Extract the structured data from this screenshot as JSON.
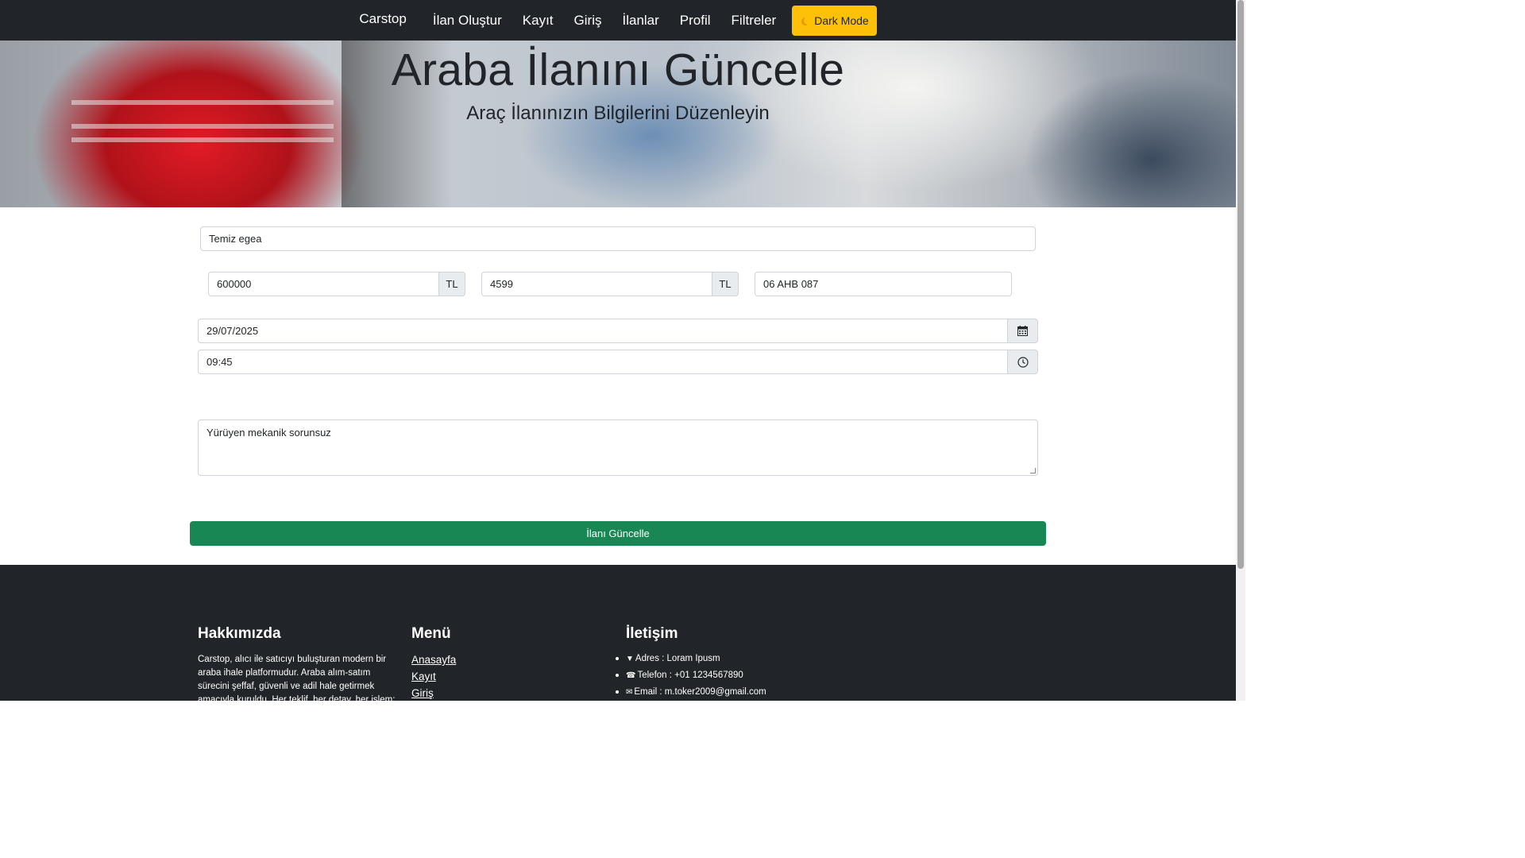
{
  "nav": {
    "brand": "Carstop",
    "links": [
      "İlan Oluştur",
      "Kayıt",
      "Giriş",
      "İlanlar",
      "Profil",
      "Filtreler"
    ],
    "dark_mode": "Dark Mode"
  },
  "hero": {
    "title": "Araba İlanını Güncelle",
    "subtitle": "Araç İlanınızın Bilgilerini Düzenleyin"
  },
  "form": {
    "title_value": "Temiz egea",
    "price_value": "600000",
    "price_unit": "TL",
    "second_value": "4599",
    "second_unit": "TL",
    "plate_value": "06 AHB 087",
    "date_value": "29/07/2025",
    "time_value": "09:45",
    "description_value": "Yürüyen mekanik sorunsuz",
    "submit_label": "İlanı Güncelle"
  },
  "footer": {
    "about_heading": "Hakkımızda",
    "about_text": "Carstop, alıcı ile satıcıyı buluşturan modern bir araba ihale platformudur. Araba alım-satım sürecini şeffaf, güvenli ve adil hale getirmek amacıyla kuruldu. Her teklif, her detay, her işlem:",
    "menu_heading": "Menü",
    "menu_links": [
      "Anasayfa",
      "Kayıt",
      "Giriş"
    ],
    "contact_heading": "İletişim",
    "contact_address": "Adres : Loram Ipusm",
    "contact_phone": "Telefon : +01 1234567890",
    "contact_email": "Email : m.toker2009@gmail.com"
  },
  "colors": {
    "navbar": "#212529",
    "accent_button": "#ffc107",
    "submit_button": "#198754",
    "footer": "#212529"
  }
}
